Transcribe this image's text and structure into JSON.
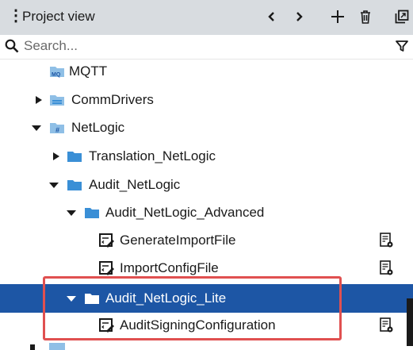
{
  "header": {
    "title": "Project view",
    "menu_glyph": "⋮",
    "icons": [
      "chevron-left-icon",
      "chevron-right-icon",
      "plus-icon",
      "trash-icon",
      "popout-icon"
    ]
  },
  "search": {
    "placeholder": "Search..."
  },
  "tree": [
    {
      "label": "MQTT",
      "icon": "mqtt-folder-icon",
      "expanded": null
    },
    {
      "label": "CommDrivers",
      "icon": "comm-drivers-folder-icon",
      "expanded": false
    },
    {
      "label": "NetLogic",
      "icon": "netlogic-folder-icon",
      "expanded": true
    },
    {
      "label": "Translation_NetLogic",
      "icon": "folder-icon",
      "expanded": false
    },
    {
      "label": "Audit_NetLogic",
      "icon": "folder-icon",
      "expanded": true
    },
    {
      "label": "Audit_NetLogic_Advanced",
      "icon": "folder-icon",
      "expanded": true
    },
    {
      "label": "GenerateImportFile",
      "icon": "netlogic-script-icon",
      "expanded": null
    },
    {
      "label": "ImportConfigFile",
      "icon": "netlogic-script-icon",
      "expanded": null
    },
    {
      "label": "Audit_NetLogic_Lite",
      "icon": "folder-icon",
      "expanded": true,
      "selected": true
    },
    {
      "label": "AuditSigningConfiguration",
      "icon": "netlogic-script-icon",
      "expanded": null
    }
  ],
  "colors": {
    "header_bg": "#d8dce0",
    "selection_bg": "#1d56a5",
    "folder_blue": "#3a8fd6",
    "highlight_border": "#e05050"
  }
}
